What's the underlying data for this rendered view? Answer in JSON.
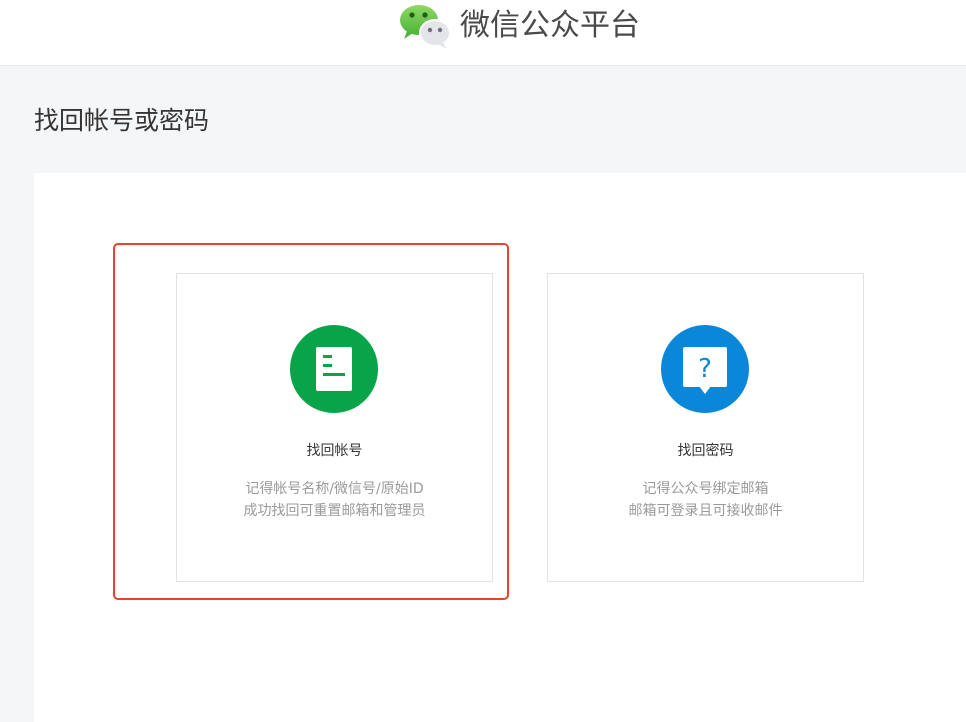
{
  "header": {
    "logo_icon": "wechat-logo-icon",
    "brand_name": "微信公众平台"
  },
  "page": {
    "title": "找回帐号或密码"
  },
  "options": [
    {
      "icon": "document-icon",
      "icon_color": "#09a34a",
      "title": "找回帐号",
      "lines": [
        "记得帐号名称/微信号/原始ID",
        "成功找回可重置邮箱和管理员"
      ]
    },
    {
      "icon": "question-bubble-icon",
      "icon_color": "#0b87da",
      "title": "找回密码",
      "lines": [
        "记得公众号绑定邮箱",
        "邮箱可登录且可接收邮件"
      ]
    }
  ],
  "highlight": {
    "color": "#e8432e"
  }
}
